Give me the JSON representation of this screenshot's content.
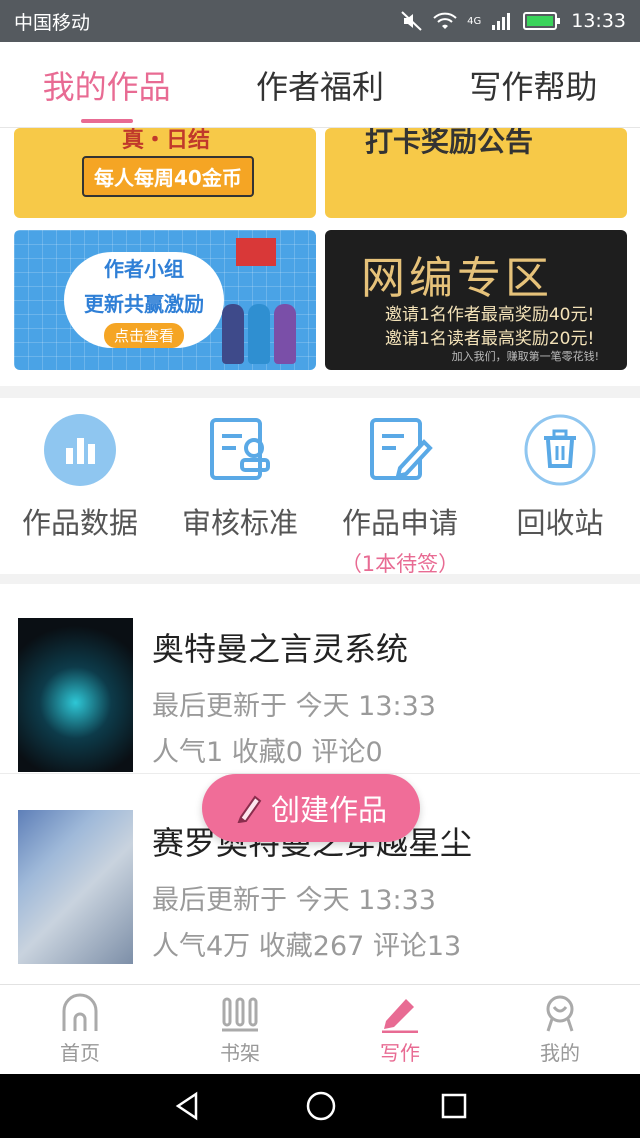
{
  "status_bar": {
    "carrier": "中国移动",
    "network": "4G",
    "time": "13:33"
  },
  "top_tabs": [
    {
      "label": "我的作品",
      "active": true
    },
    {
      "label": "作者福利",
      "active": false
    },
    {
      "label": "写作帮助",
      "active": false
    }
  ],
  "banners": [
    {
      "top_text": "真・日结",
      "text": "每人每周40金币"
    },
    {
      "text": "打卡奖励公告"
    },
    {
      "line1": "作者小组",
      "line2": "更新共赢激励",
      "button": "点击查看"
    },
    {
      "title": "网编专区",
      "line1": "邀请1名作者最高奖励40元!",
      "line2": "邀请1名读者最高奖励20元!",
      "footer": "加入我们，赚取第一笔零花钱!"
    }
  ],
  "tools": [
    {
      "label": "作品数据",
      "icon": "bar-chart-icon"
    },
    {
      "label": "审核标准",
      "icon": "review-doc-icon"
    },
    {
      "label": "作品申请",
      "sub": "（1本待签）",
      "icon": "edit-doc-icon"
    },
    {
      "label": "回收站",
      "icon": "trash-icon"
    }
  ],
  "works": [
    {
      "title": "奥特曼之言灵系统",
      "updated": "最后更新于 今天 13:33",
      "stats": "人气1 收藏0 评论0"
    },
    {
      "title": "赛罗奥特曼之穿越星尘",
      "updated": "最后更新于 今天 13:33",
      "stats": "人气4万 收藏267 评论13"
    }
  ],
  "fab": {
    "label": "创建作品"
  },
  "bottom_nav": [
    {
      "label": "首页",
      "icon": "home-icon",
      "active": false
    },
    {
      "label": "书架",
      "icon": "bookshelf-icon",
      "active": false
    },
    {
      "label": "写作",
      "icon": "pen-icon",
      "active": true
    },
    {
      "label": "我的",
      "icon": "profile-icon",
      "active": false
    }
  ],
  "colors": {
    "accent": "#e86b93",
    "tool_blue": "#5aa9e6",
    "fab": "#f06d98"
  }
}
